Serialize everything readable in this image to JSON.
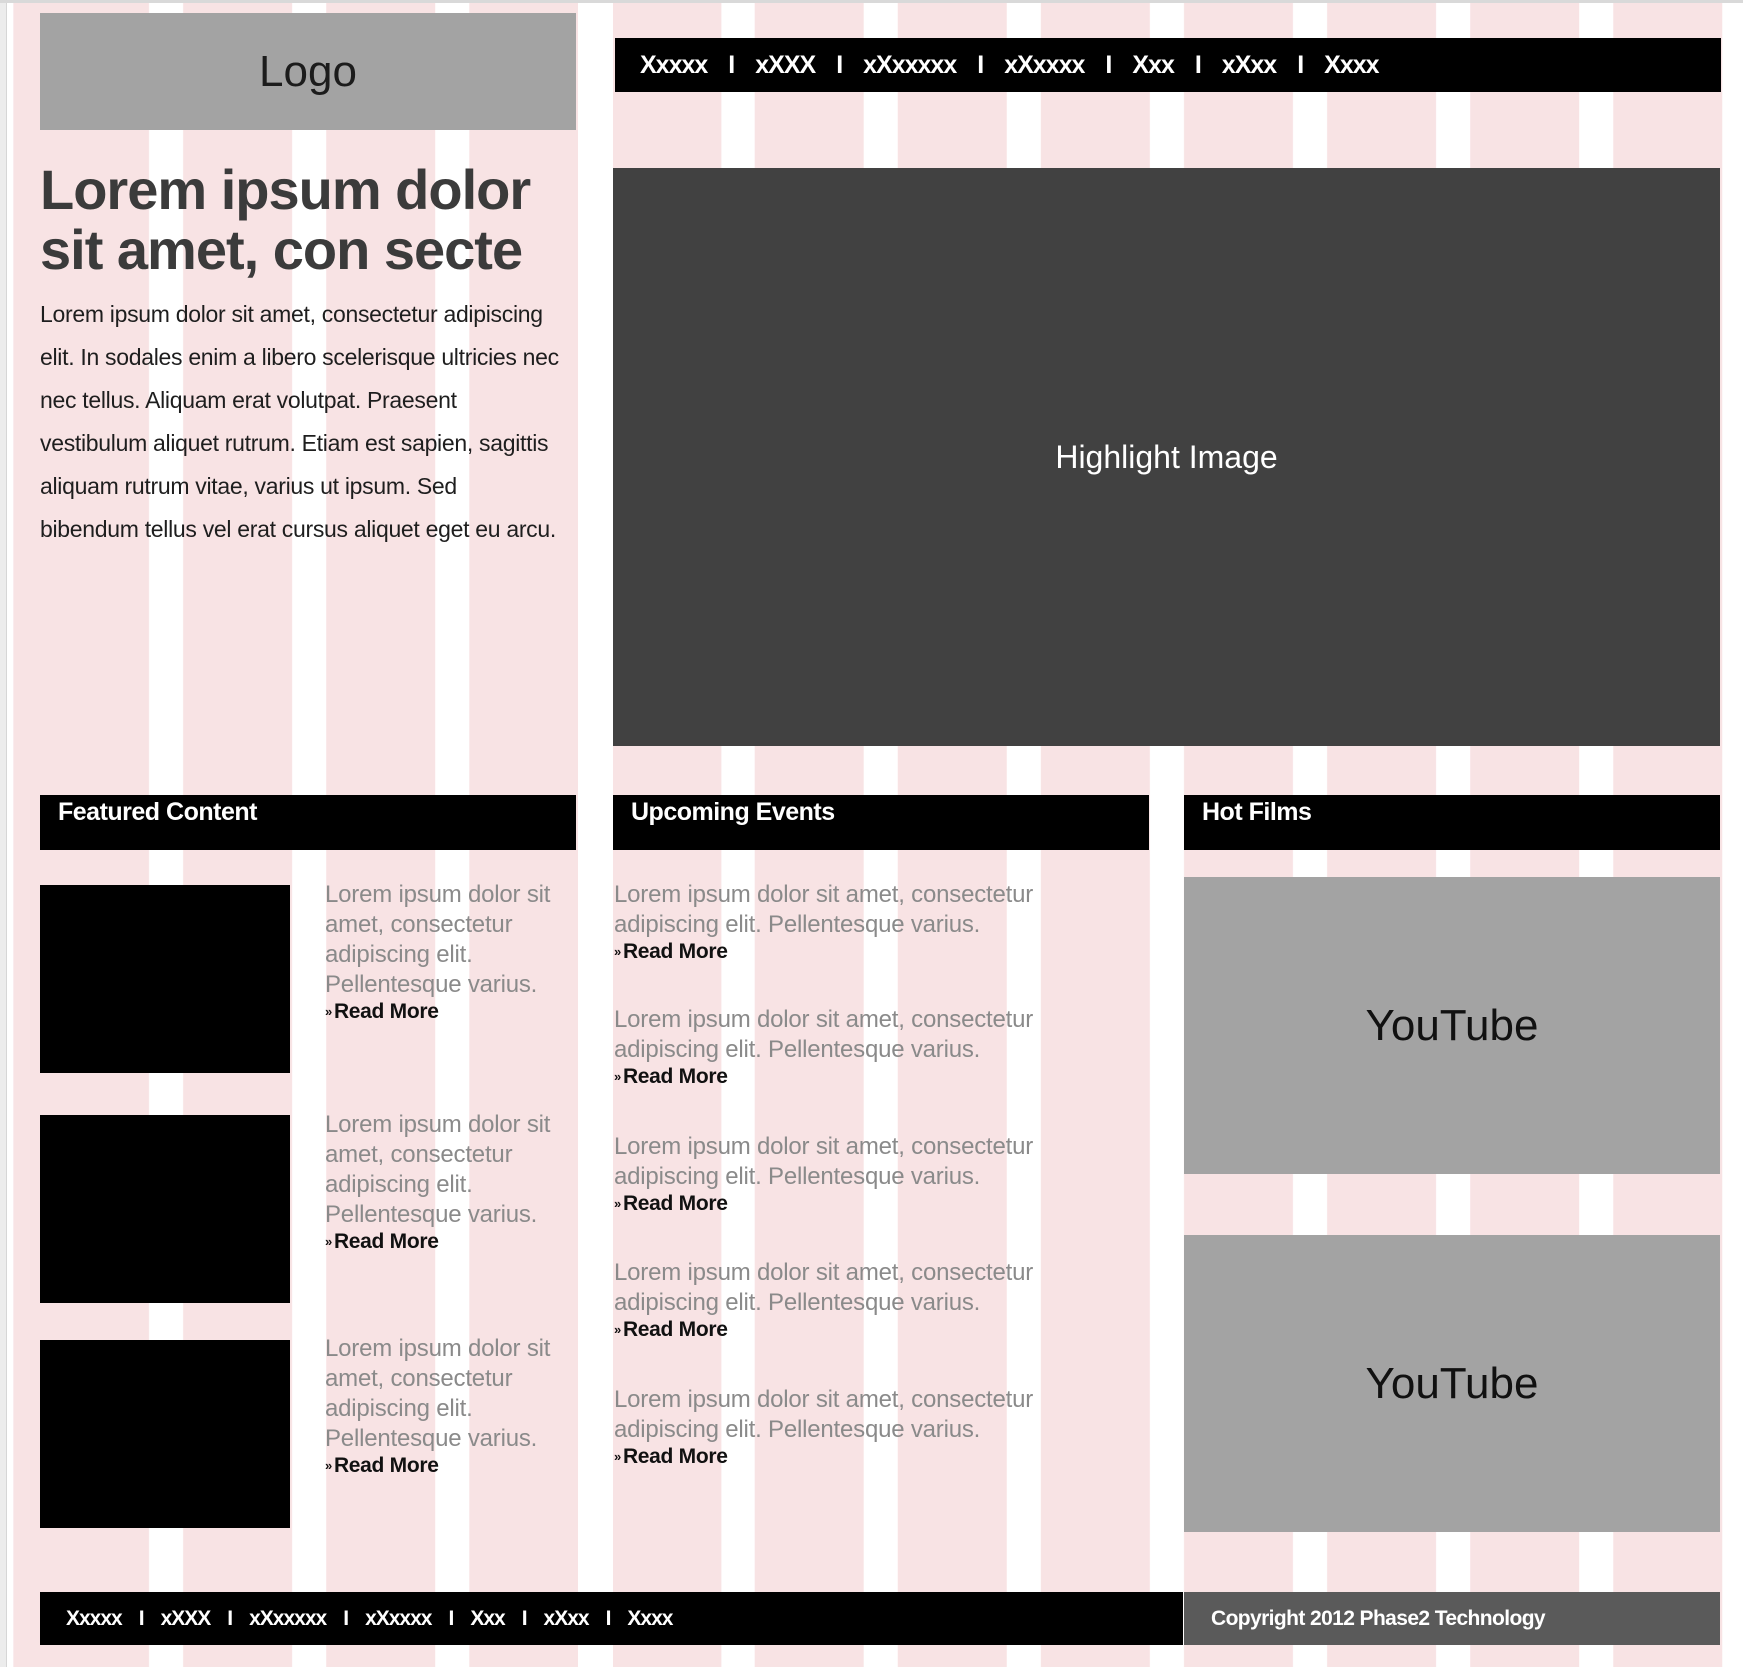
{
  "header": {
    "logo_label": "Logo",
    "nav": [
      "Xxxxx",
      "xXXX",
      "xXxxxxx",
      "xXxxxx",
      "Xxx",
      "xXxx",
      "Xxxx"
    ],
    "nav_separator": "I"
  },
  "intro": {
    "headline": "Lorem ipsum dolor sit amet, con secte",
    "body": "Lorem ipsum dolor sit amet, consectetur adipiscing elit. In sodales enim a libero scelerisque ultricies nec nec tellus. Aliquam erat volutpat. Praesent vestibulum aliquet rutrum. Etiam est sapien, sagittis aliquam rutrum vitae, varius ut ipsum. Sed bibendum tellus vel erat cursus aliquet eget eu arcu."
  },
  "highlight": {
    "label": "Highlight Image"
  },
  "featured": {
    "title": "Featured Content",
    "items": [
      {
        "text": "Lorem ipsum dolor sit amet, consectetur adipiscing elit. Pellentesque varius.",
        "read_more": "Read More"
      },
      {
        "text": "Lorem ipsum dolor sit amet, consectetur adipiscing elit. Pellentesque varius.",
        "read_more": "Read More"
      },
      {
        "text": "Lorem ipsum dolor sit amet, consectetur adipiscing elit. Pellentesque varius.",
        "read_more": "Read More"
      }
    ]
  },
  "events": {
    "title": "Upcoming Events",
    "items": [
      {
        "text": "Lorem ipsum dolor sit amet, consectetur adipiscing elit. Pellentesque varius.",
        "read_more": "Read More"
      },
      {
        "text": "Lorem ipsum dolor sit amet, consectetur adipiscing elit. Pellentesque varius.",
        "read_more": "Read More"
      },
      {
        "text": "Lorem ipsum dolor sit amet, consectetur adipiscing elit. Pellentesque varius.",
        "read_more": "Read More"
      },
      {
        "text": "Lorem ipsum dolor sit amet, consectetur adipiscing elit. Pellentesque varius.",
        "read_more": "Read More"
      },
      {
        "text": "Lorem ipsum dolor sit amet, consectetur adipiscing elit. Pellentesque varius.",
        "read_more": "Read More"
      }
    ]
  },
  "films": {
    "title": "Hot Films",
    "videos": [
      "YouTube",
      "YouTube"
    ]
  },
  "footer": {
    "nav": [
      "Xxxxx",
      "xXXX",
      "xXxxxxx",
      "xXxxxx",
      "Xxx",
      "xXxx",
      "Xxxx"
    ],
    "nav_separator": "I",
    "copyright": "Copyright 2012 Phase2 Technology"
  },
  "icons": {
    "read_more_bullet": "double-chevron-right-icon"
  },
  "colors": {
    "grid_column": "#f8e3e4",
    "bar_black": "#000000",
    "placeholder_gray": "#a3a3a3",
    "highlight_dark": "#414141",
    "copyright_bg": "#5a5a5a",
    "muted_text": "#8a8a8a"
  }
}
